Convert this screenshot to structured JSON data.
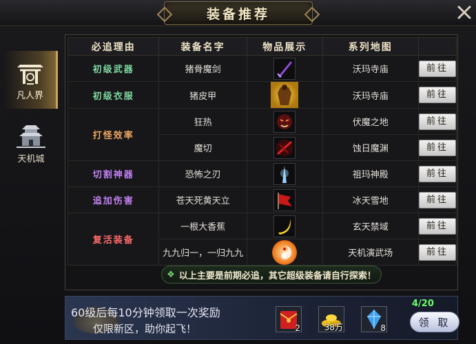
{
  "window": {
    "title": "装备推荐"
  },
  "sidebar": {
    "tabs": [
      {
        "label": "凡人界",
        "active": true,
        "icon": "temple-gate-icon"
      },
      {
        "label": "天机城",
        "active": false,
        "icon": "pagoda-city-icon"
      }
    ]
  },
  "table": {
    "headers": [
      "必追理由",
      "装备名字",
      "物品展示",
      "系列地图",
      ""
    ],
    "groups": [
      {
        "reason": "初级武器",
        "color": "#7fd7a0",
        "rows": [
          {
            "name": "猪骨魔剑",
            "item_icon": "purple-sword-icon",
            "map": "沃玛寺庙",
            "button": "前往"
          }
        ]
      },
      {
        "reason": "初级衣服",
        "color": "#7fd7a0",
        "rows": [
          {
            "name": "猪皮甲",
            "item_icon": "golden-armor-icon",
            "map": "沃玛寺庙",
            "button": "前往"
          }
        ]
      },
      {
        "reason": "打怪效率",
        "color": "#f0a860",
        "rows": [
          {
            "name": "狂热",
            "item_icon": "frenzy-mask-icon",
            "map": "伏魔之地",
            "button": "前往"
          },
          {
            "name": "魔切",
            "item_icon": "red-slash-icon",
            "map": "蚀日魔渊",
            "button": "前往"
          }
        ]
      },
      {
        "reason": "切割神器",
        "color": "#c080f0",
        "rows": [
          {
            "name": "恐怖之刃",
            "item_icon": "blue-blade-icon",
            "map": "祖玛神殿",
            "button": "前往"
          }
        ]
      },
      {
        "reason": "追加伤害",
        "color": "#c080f0",
        "rows": [
          {
            "name": "苍天死黄天立",
            "item_icon": "red-banner-icon",
            "map": "冰天雪地",
            "button": "前往"
          }
        ]
      },
      {
        "reason": "复活装备",
        "color": "#ff6a6a",
        "rows": [
          {
            "name": "一根大香蕉",
            "item_icon": "banana-icon",
            "map": "玄天禁域",
            "button": "前往"
          },
          {
            "name": "九九归一，一归九九",
            "item_icon": "taiji-orb-icon",
            "map": "天机演武场",
            "button": "前往"
          }
        ]
      }
    ]
  },
  "notice": {
    "text": "以上主要是前期必追，其它超级装备请自行探索！"
  },
  "reward": {
    "line1": "60级后每10分钟领取一次奖励",
    "line2": "仅限新区，助你起飞！",
    "progress": "4/20",
    "items": [
      {
        "icon": "red-envelope-icon",
        "count": "2"
      },
      {
        "icon": "gold-pile-icon",
        "count": "38万"
      },
      {
        "icon": "blue-crystal-icon",
        "count": "8"
      }
    ],
    "claim_label": "领 取"
  }
}
